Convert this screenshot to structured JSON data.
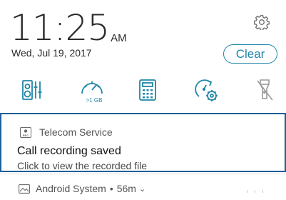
{
  "header": {
    "time": "11:25",
    "ampm": "AM",
    "date": "Wed, Jul 19, 2017",
    "clear_label": "Clear",
    "settings_icon": "gear-icon"
  },
  "quick_settings": {
    "accent_color": "#1f86a8",
    "items": [
      {
        "icon": "audio-wizard-icon"
      },
      {
        "icon": "boost-icon",
        "label": ">1 GB"
      },
      {
        "icon": "calculator-icon"
      },
      {
        "icon": "auto-start-icon"
      },
      {
        "icon": "flashlight-off-icon"
      }
    ]
  },
  "notifications": [
    {
      "app": "Telecom Service",
      "icon": "rec-icon",
      "title": "Call recording saved",
      "text": "Click to view the recorded file",
      "highlight_color": "#1d5f9a"
    },
    {
      "app": "Android System",
      "icon": "image-icon",
      "separator": "•",
      "time": "56m"
    }
  ]
}
